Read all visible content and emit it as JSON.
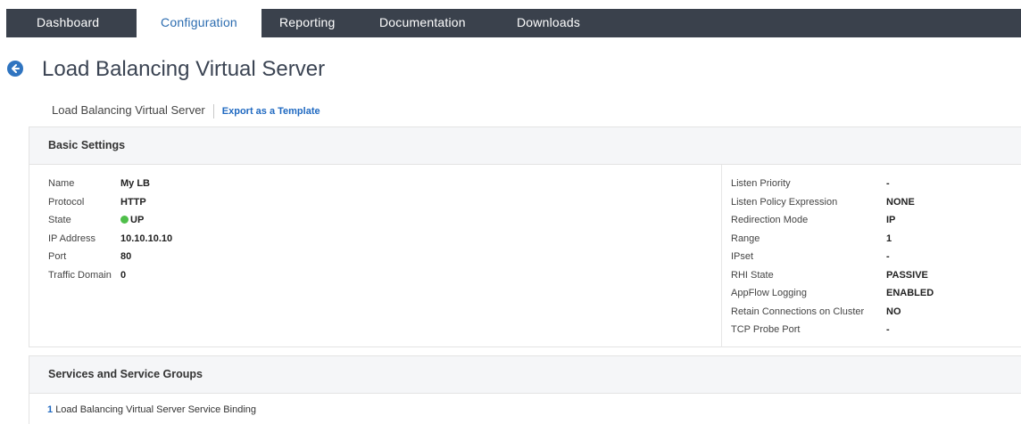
{
  "nav": {
    "tabs": [
      {
        "label": "Dashboard",
        "active": false
      },
      {
        "label": "Configuration",
        "active": true
      },
      {
        "label": "Reporting",
        "active": false
      },
      {
        "label": "Documentation",
        "active": false
      },
      {
        "label": "Downloads",
        "active": false
      }
    ]
  },
  "header": {
    "back_icon": "arrow-left-circle-icon",
    "title": "Load Balancing Virtual Server"
  },
  "breadcrumb": {
    "current": "Load Balancing Virtual Server",
    "action": "Export as a Template"
  },
  "basic_settings": {
    "title": "Basic Settings",
    "left": [
      {
        "label": "Name",
        "value": "My LB"
      },
      {
        "label": "Protocol",
        "value": "HTTP"
      },
      {
        "label": "State",
        "value": "UP"
      },
      {
        "label": "IP Address",
        "value": "10.10.10.10"
      },
      {
        "label": "Port",
        "value": "80"
      },
      {
        "label": "Traffic Domain",
        "value": "0"
      }
    ],
    "right": [
      {
        "label": "Listen Priority",
        "value": "-"
      },
      {
        "label": "Listen Policy Expression",
        "value": "NONE"
      },
      {
        "label": "Redirection Mode",
        "value": "IP"
      },
      {
        "label": "Range",
        "value": "1"
      },
      {
        "label": "IPset",
        "value": "-"
      },
      {
        "label": "RHI State",
        "value": "PASSIVE"
      },
      {
        "label": "AppFlow Logging",
        "value": "ENABLED"
      },
      {
        "label": "Retain Connections on Cluster",
        "value": "NO"
      },
      {
        "label": "TCP Probe Port",
        "value": "-"
      }
    ]
  },
  "services": {
    "title": "Services and Service Groups",
    "binding_count": "1",
    "binding_label": "Load Balancing Virtual Server Service Binding"
  },
  "colors": {
    "nav_bg": "#3a414c",
    "accent": "#1f69c1",
    "status_up": "#4fbf4a"
  }
}
